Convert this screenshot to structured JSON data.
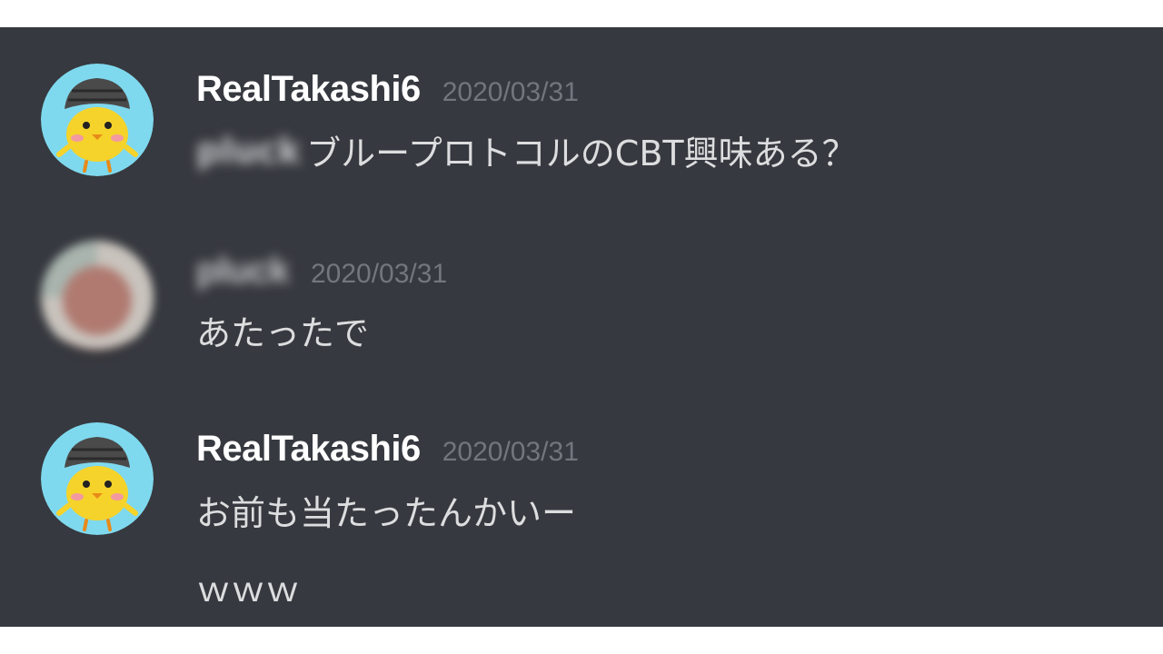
{
  "messages": [
    {
      "author": "RealTakashi6",
      "timestamp": "2020/03/31",
      "mention": "pluck",
      "lines": [
        "ブループロトコルのCBT興味ある？"
      ]
    },
    {
      "author": "pluck",
      "timestamp": "2020/03/31",
      "lines": [
        "あたったで"
      ]
    },
    {
      "author": "RealTakashi6",
      "timestamp": "2020/03/31",
      "lines": [
        "お前も当たったんかいー",
        "ｗｗｗ"
      ]
    }
  ],
  "colors": {
    "background": "#36393f",
    "username": "#ffffff",
    "timestamp": "#72767d",
    "message_text": "#dcddde",
    "avatar_ring": "#7fd9ee",
    "chick_yellow": "#f6d32a"
  },
  "icons": {
    "avatar_1": "chick-with-helmet-avatar",
    "avatar_2": "blurred-user-avatar",
    "avatar_3": "chick-with-helmet-avatar"
  }
}
